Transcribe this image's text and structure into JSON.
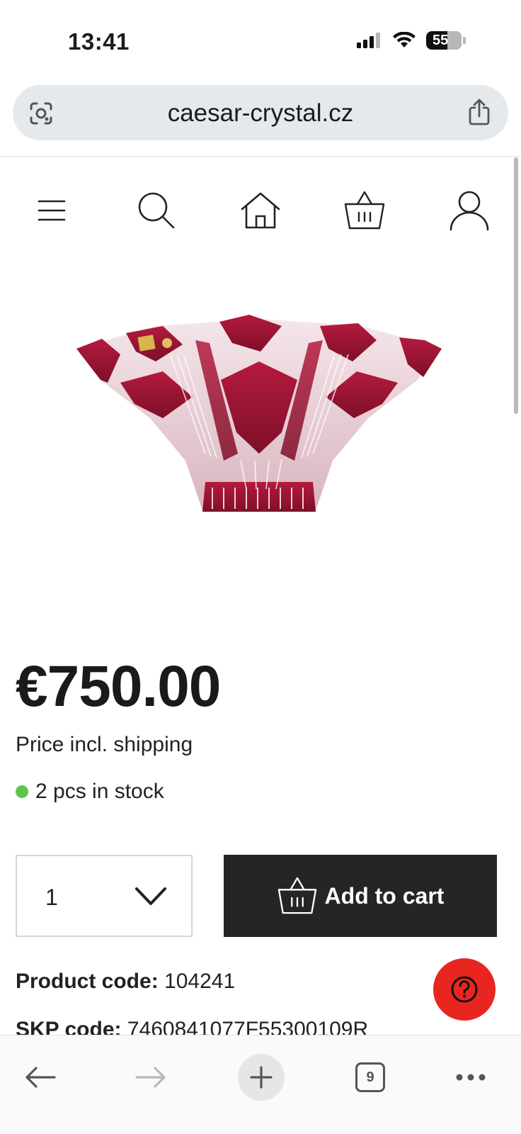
{
  "status_bar": {
    "time": "13:41",
    "battery": "55"
  },
  "browser": {
    "url": "caesar-crystal.cz",
    "tab_count": "9"
  },
  "site_nav": {
    "icons": [
      "menu-icon",
      "search-icon",
      "home-icon",
      "basket-icon",
      "account-icon"
    ]
  },
  "product": {
    "image": "ruby-red-cut-crystal-bowl",
    "price": "€750.00",
    "price_note": "Price incl. shipping",
    "stock": "2 pcs in stock",
    "stock_color": "#5ec44a",
    "quantity": "1",
    "add_to_cart_label": "Add to cart",
    "product_code_label": "Product code:",
    "product_code": "104241",
    "skp_code_label": "SKP code:",
    "skp_code": "7460841077F55300109R"
  },
  "colors": {
    "cart_button": "#252525",
    "help_button": "#e8261f",
    "url_bar": "#e6e9ec"
  }
}
